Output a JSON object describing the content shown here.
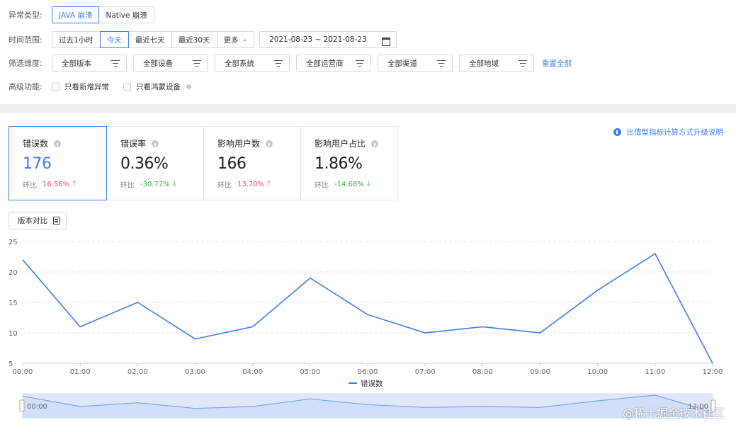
{
  "filters": {
    "crash_type_label": "异常类型:",
    "crash_types": [
      "JAVA 崩溃",
      "Native 崩溃"
    ],
    "time_label": "时间范围:",
    "time_ranges": [
      "过去1小时",
      "今天",
      "最近七天",
      "最近30天",
      "更多"
    ],
    "date_range": "2021-08-23 ~ 2021-08-23",
    "dimension_label": "筛选维度:",
    "dimensions": [
      "全部版本",
      "全部设备",
      "全部系统",
      "全部运营商",
      "全部渠道",
      "全部地域"
    ],
    "reset_label": "重置全部",
    "advanced_label": "高级功能:",
    "advanced_options": [
      "只看新增异常",
      "只看鸿蒙设备"
    ]
  },
  "metrics": [
    {
      "title": "错误数",
      "value": "176",
      "cmp_label": "环比",
      "change": "16.56%",
      "dir": "up"
    },
    {
      "title": "错误率",
      "value": "0.36%",
      "cmp_label": "环比",
      "change": "-30.77%",
      "dir": "down"
    },
    {
      "title": "影响用户数",
      "value": "166",
      "cmp_label": "环比",
      "change": "13.70%",
      "dir": "up"
    },
    {
      "title": "影响用户占比",
      "value": "1.86%",
      "cmp_label": "环比",
      "change": "-14.68%",
      "dir": "down"
    }
  ],
  "upgrade_note": "比值型指标计算方式升级说明",
  "version_compare_label": "版本对比",
  "watermark": "@稀土掘金技术社区",
  "colors": {
    "accent": "#3d7ff5",
    "up": "#f04864",
    "down": "#2fb344"
  },
  "chart_data": {
    "type": "line",
    "x": [
      "00:00",
      "01:00",
      "02:00",
      "03:00",
      "04:00",
      "05:00",
      "06:00",
      "07:00",
      "08:00",
      "09:00",
      "10:00",
      "11:00",
      "12:00"
    ],
    "series": [
      {
        "name": "错误数",
        "values": [
          22,
          11,
          15,
          9,
          11,
          19,
          13,
          10,
          11,
          10,
          17,
          23,
          5
        ]
      }
    ],
    "ylim": [
      5,
      25
    ],
    "yticks": [
      5,
      10,
      15,
      20,
      25
    ],
    "grid": true,
    "legend": "bottom-center",
    "zoom_slider": {
      "start_label": "00:00",
      "end_label": "12:00"
    }
  }
}
